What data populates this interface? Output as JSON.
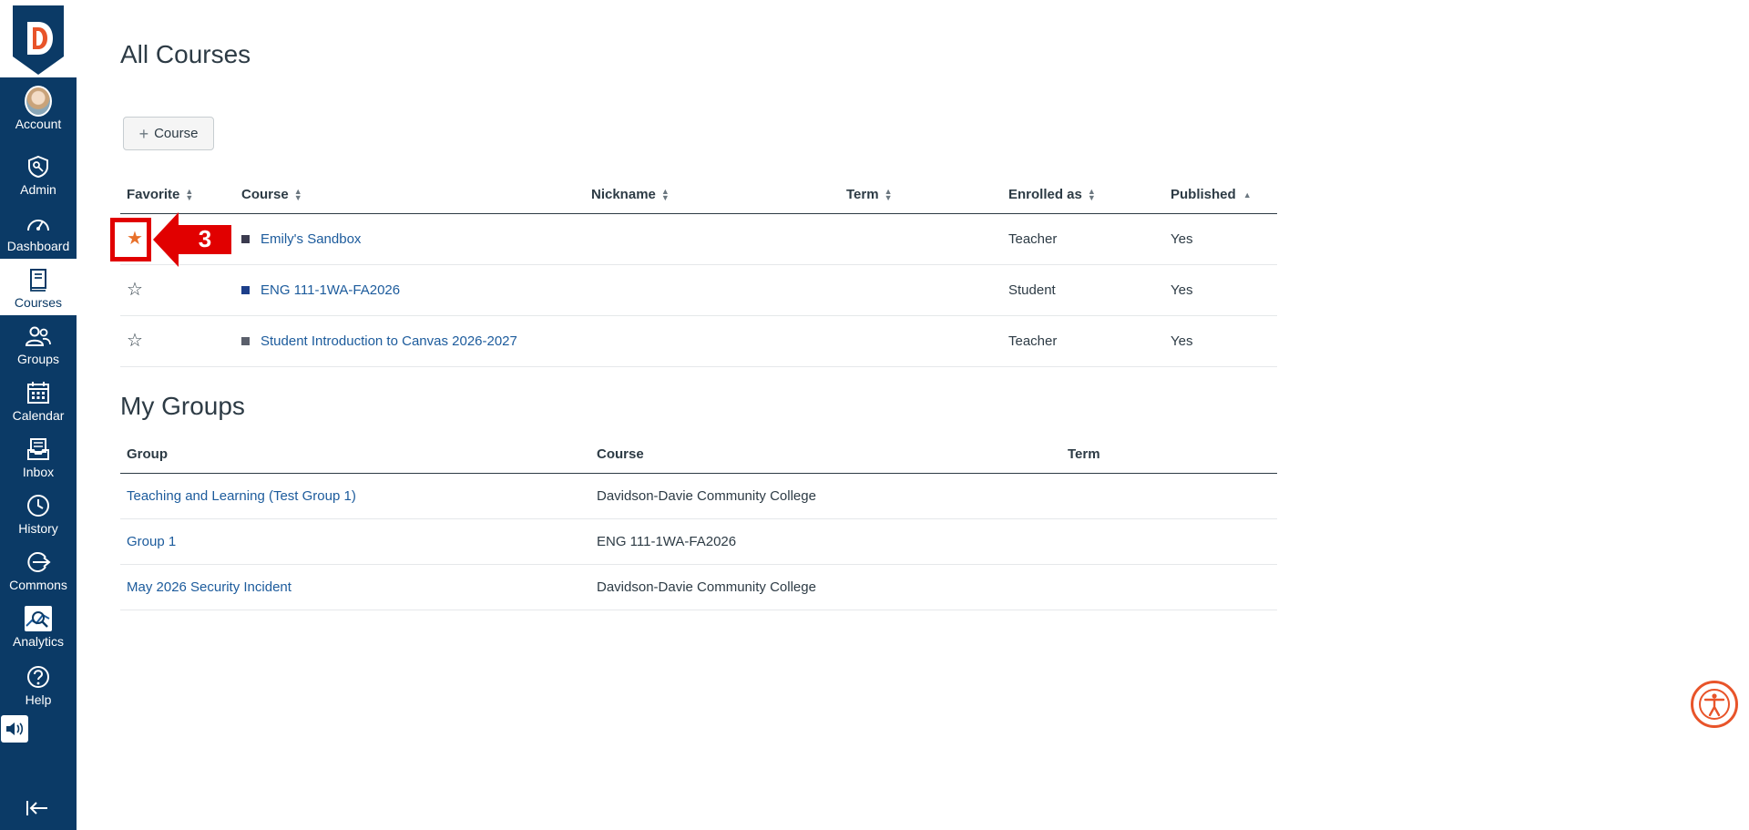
{
  "nav": {
    "items": [
      {
        "label": "Account",
        "icon": "avatar"
      },
      {
        "label": "Admin",
        "icon": "admin-shield-icon"
      },
      {
        "label": "Dashboard",
        "icon": "dashboard-gauge-icon"
      },
      {
        "label": "Courses",
        "icon": "courses-book-icon",
        "active": true
      },
      {
        "label": "Groups",
        "icon": "groups-people-icon"
      },
      {
        "label": "Calendar",
        "icon": "calendar-icon"
      },
      {
        "label": "Inbox",
        "icon": "inbox-icon"
      },
      {
        "label": "History",
        "icon": "history-clock-icon"
      },
      {
        "label": "Commons",
        "icon": "commons-icon"
      },
      {
        "label": "Analytics",
        "icon": "analytics-icon"
      },
      {
        "label": "Help",
        "icon": "help-icon"
      }
    ]
  },
  "page": {
    "title": "All Courses",
    "add_course_label": "Course"
  },
  "courses": {
    "headers": {
      "favorite": "Favorite",
      "course": "Course",
      "nickname": "Nickname",
      "term": "Term",
      "enrolled_as": "Enrolled as",
      "published": "Published"
    },
    "rows": [
      {
        "favorite": true,
        "color": "#3b3b4f",
        "name": "Emily's Sandbox",
        "nickname": "",
        "term": "",
        "enrolled_as": "Teacher",
        "published": "Yes"
      },
      {
        "favorite": false,
        "color": "#1d3f8a",
        "name": "ENG 111-1WA-FA2026",
        "nickname": "",
        "term": "",
        "enrolled_as": "Student",
        "published": "Yes"
      },
      {
        "favorite": false,
        "color": "#5a5f6b",
        "name": "Student Introduction to Canvas 2026-2027",
        "nickname": "",
        "term": "",
        "enrolled_as": "Teacher",
        "published": "Yes"
      }
    ]
  },
  "groups": {
    "title": "My Groups",
    "headers": {
      "group": "Group",
      "course": "Course",
      "term": "Term"
    },
    "rows": [
      {
        "group": "Teaching and Learning (Test Group 1)",
        "course": "Davidson-Davie Community College",
        "term": ""
      },
      {
        "group": "Group 1",
        "course": "ENG 111-1WA-FA2026",
        "term": ""
      },
      {
        "group": "May 2026 Security Incident",
        "course": "Davidson-Davie Community College",
        "term": ""
      }
    ]
  },
  "annotation": {
    "step_number": "3",
    "color": "#e10000"
  },
  "colors": {
    "nav_bg": "#0b3a66",
    "link": "#1c5b9c",
    "favorite_star": "#e8702a",
    "brand_accent": "#e8542a"
  }
}
